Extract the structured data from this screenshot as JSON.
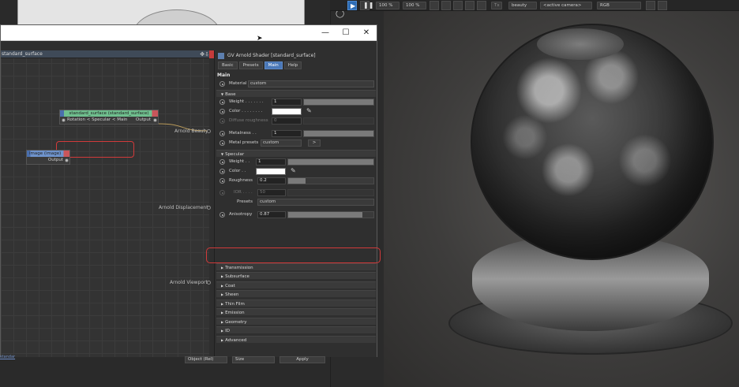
{
  "render_toolbar": {
    "zoom_a": "100 %",
    "zoom_b": "100 %",
    "tx_label": "Tx",
    "aov": "beauty",
    "camera": "<active camera>",
    "color_space": "RGB"
  },
  "dialog": {
    "minimize": "—",
    "maximize": "☐",
    "close": "✕"
  },
  "node_editor": {
    "header_title": "standard_surface",
    "header_icons": "✥⇩",
    "nodes": {
      "standard_surface": {
        "title": "standard_surface (standard_surface)",
        "input_label": "Rotation < Specular < Main",
        "output_label": "Output"
      },
      "image": {
        "title": "image (image)",
        "output_label": "Output"
      }
    },
    "ports": {
      "beauty": "Arnold Beauty",
      "displacement": "Arnold Displacement",
      "viewport": "Arnold Viewport"
    }
  },
  "attributes": {
    "title": "GV Arnold Shader [standard_surface]",
    "tabs": [
      "Basic",
      "Presets",
      "Main",
      "Help"
    ],
    "active_tab": "Main",
    "section": "Main",
    "material_label": "Material",
    "material_value": "custom",
    "base": {
      "header": "Base",
      "weight_label": "Weight . . . . . . .",
      "weight_value": "1",
      "weight_level": 1.0,
      "color_label": "Color . . . . . . . .",
      "diffuse_label": "Diffuse roughness",
      "diffuse_value": "0",
      "metalness_label": "Metalness . .",
      "metalness_value": "1",
      "metalness_level": 1.0,
      "metal_presets_label": "Metal presets",
      "metal_presets_value": "custom",
      "metal_presets_button": ">"
    },
    "specular": {
      "header": "Specular",
      "weight_label": "Weight . .",
      "weight_value": "1",
      "weight_level": 1.0,
      "color_label": "Color . .",
      "roughness_label": "Roughness",
      "roughness_value": "0.2",
      "roughness_level": 0.2,
      "ior_label": "IOR . . . .",
      "ior_value": "50",
      "presets_label": "Presets",
      "presets_value": "custom",
      "anisotropy_label": "Anisotropy",
      "anisotropy_value": "0.87",
      "anisotropy_level": 0.87
    },
    "groups": [
      "Transmission",
      "Subsurface",
      "Coat",
      "Sheen",
      "Thin Film",
      "Emission",
      "Geometry",
      "ID",
      "Advanced"
    ]
  },
  "bottom_bar": {
    "object": "Object (Rel)",
    "size": "Size",
    "apply": "Apply",
    "link": "standar"
  },
  "colors": {
    "accent": "#4a78b8",
    "annotation": "#d23a3a",
    "node_header_green": "#6fbf8e",
    "node_header_red": "#c9565b"
  }
}
